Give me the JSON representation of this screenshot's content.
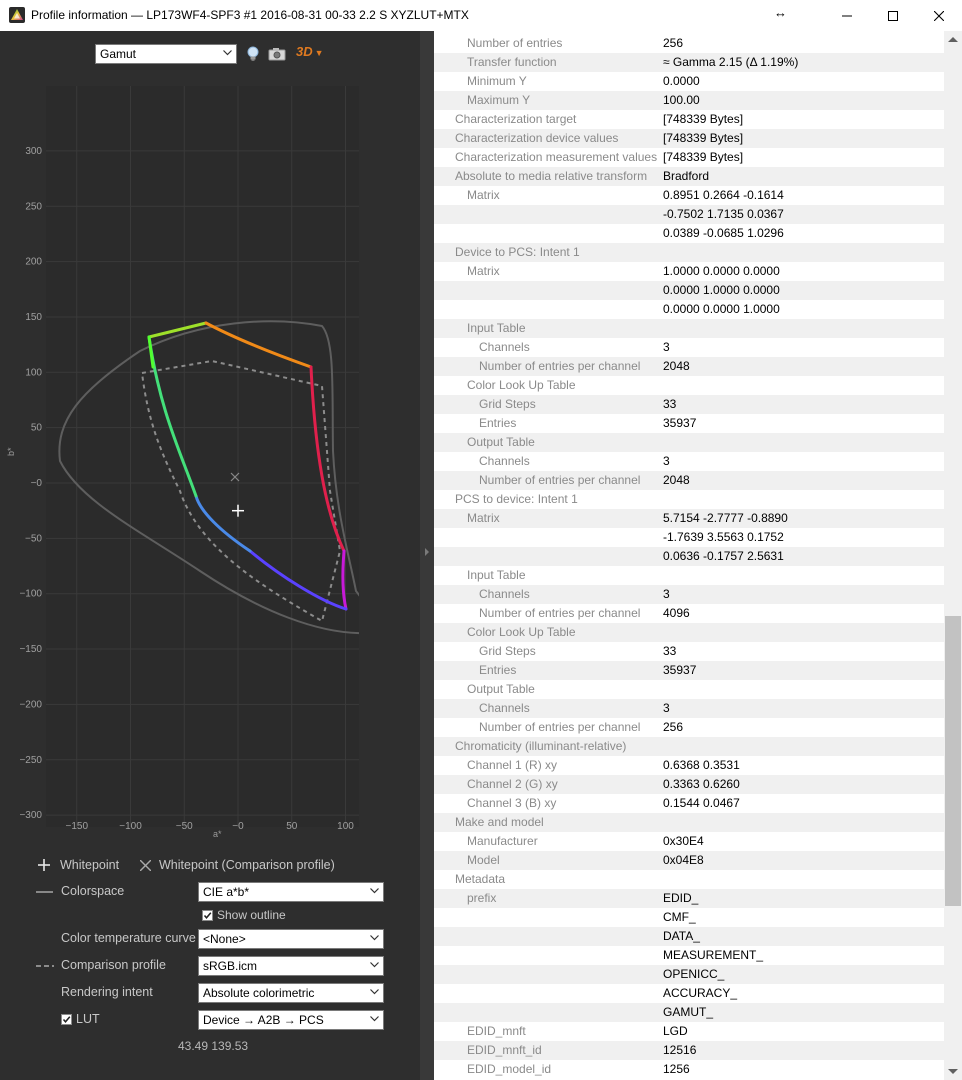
{
  "window": {
    "title": "Profile information — LP173WF4-SPF3 #1 2016-08-31 00-33 2.2 S XYZLUT+MTX",
    "minimize_glyph": "─",
    "maximize_glyph": "☐",
    "close_glyph": "✕",
    "resize_glyph": "↔"
  },
  "toolbar": {
    "view_select": "Gamut",
    "icons": [
      "lightbulb-icon",
      "camera-icon",
      "3d-icon"
    ],
    "three_d_label": "3D"
  },
  "plot": {
    "x_ticks": [
      "−150",
      "−100",
      "−50",
      "−0",
      "50",
      "100"
    ],
    "y_ticks": [
      "300",
      "250",
      "200",
      "150",
      "100",
      "50",
      "−0",
      "−50",
      "−100",
      "−150",
      "−200",
      "−250",
      "−300"
    ],
    "xlabel": "a*",
    "ylabel": "b*",
    "whitepoint": {
      "a": 0,
      "b": -25
    },
    "axis_range": {
      "a": [
        -180,
        110
      ],
      "b": [
        -335,
        330
      ]
    }
  },
  "legend": {
    "whitepoint": "Whitepoint",
    "whitepoint_comparison": "Whitepoint (Comparison profile)"
  },
  "options": {
    "colorspace_label": "Colorspace",
    "colorspace_value": "CIE a*b*",
    "show_outline_label": "Show outline",
    "show_outline_checked": true,
    "color_temp_label": "Color temperature curve",
    "color_temp_value": "<None>",
    "comparison_label": "Comparison profile",
    "comparison_value": "sRGB.icm",
    "rendering_label": "Rendering intent",
    "rendering_value": "Absolute colorimetric",
    "lut_label": "LUT",
    "lut_checked": true,
    "lut_value": "Device → A2B → PCS"
  },
  "readout": "43.49 139.53",
  "info_rows": [
    {
      "k": "Number of entries",
      "v": "256",
      "lvl": 1
    },
    {
      "k": "Transfer function",
      "v": "≈ Gamma 2.15 (Δ 1.19%)",
      "lvl": 1
    },
    {
      "k": "Minimum Y",
      "v": "0.0000",
      "lvl": 1
    },
    {
      "k": "Maximum Y",
      "v": "100.00",
      "lvl": 1
    },
    {
      "k": "Characterization target",
      "v": "[748339 Bytes]",
      "lvl": 0
    },
    {
      "k": "Characterization device values",
      "v": "[748339 Bytes]",
      "lvl": 0
    },
    {
      "k": "Characterization measurement values",
      "v": "[748339 Bytes]",
      "lvl": 0
    },
    {
      "k": "Absolute to media relative transform",
      "v": "Bradford",
      "lvl": 0
    },
    {
      "k": "Matrix",
      "v": "0.8951 0.2664 -0.1614",
      "lvl": 1
    },
    {
      "k": "",
      "v": "-0.7502 1.7135 0.0367",
      "lvl": 1
    },
    {
      "k": "",
      "v": "0.0389 -0.0685 1.0296",
      "lvl": 1
    },
    {
      "k": "Device to PCS: Intent 1",
      "v": "",
      "lvl": 0
    },
    {
      "k": "Matrix",
      "v": "1.0000 0.0000 0.0000",
      "lvl": 1
    },
    {
      "k": "",
      "v": "0.0000 1.0000 0.0000",
      "lvl": 1
    },
    {
      "k": "",
      "v": "0.0000 0.0000 1.0000",
      "lvl": 1
    },
    {
      "k": "Input Table",
      "v": "",
      "lvl": 1
    },
    {
      "k": "Channels",
      "v": "3",
      "lvl": 2
    },
    {
      "k": "Number of entries per channel",
      "v": "2048",
      "lvl": 2
    },
    {
      "k": "Color Look Up Table",
      "v": "",
      "lvl": 1
    },
    {
      "k": "Grid Steps",
      "v": "33",
      "lvl": 2
    },
    {
      "k": "Entries",
      "v": "35937",
      "lvl": 2
    },
    {
      "k": "Output Table",
      "v": "",
      "lvl": 1
    },
    {
      "k": "Channels",
      "v": "3",
      "lvl": 2
    },
    {
      "k": "Number of entries per channel",
      "v": "2048",
      "lvl": 2
    },
    {
      "k": "PCS to device: Intent 1",
      "v": "",
      "lvl": 0
    },
    {
      "k": "Matrix",
      "v": "5.7154 -2.7777 -0.8890",
      "lvl": 1
    },
    {
      "k": "",
      "v": "-1.7639 3.5563 0.1752",
      "lvl": 1
    },
    {
      "k": "",
      "v": "0.0636 -0.1757 2.5631",
      "lvl": 1
    },
    {
      "k": "Input Table",
      "v": "",
      "lvl": 1
    },
    {
      "k": "Channels",
      "v": "3",
      "lvl": 2
    },
    {
      "k": "Number of entries per channel",
      "v": "4096",
      "lvl": 2
    },
    {
      "k": "Color Look Up Table",
      "v": "",
      "lvl": 1
    },
    {
      "k": "Grid Steps",
      "v": "33",
      "lvl": 2
    },
    {
      "k": "Entries",
      "v": "35937",
      "lvl": 2
    },
    {
      "k": "Output Table",
      "v": "",
      "lvl": 1
    },
    {
      "k": "Channels",
      "v": "3",
      "lvl": 2
    },
    {
      "k": "Number of entries per channel",
      "v": "256",
      "lvl": 2
    },
    {
      "k": "Chromaticity (illuminant-relative)",
      "v": "",
      "lvl": 0
    },
    {
      "k": "Channel 1 (R) xy",
      "v": "0.6368 0.3531",
      "lvl": 1
    },
    {
      "k": "Channel 2 (G) xy",
      "v": "0.3363 0.6260",
      "lvl": 1
    },
    {
      "k": "Channel 3 (B) xy",
      "v": "0.1544 0.0467",
      "lvl": 1
    },
    {
      "k": "Make and model",
      "v": "",
      "lvl": 0
    },
    {
      "k": "Manufacturer",
      "v": "0x30E4",
      "lvl": 1
    },
    {
      "k": "Model",
      "v": "0x04E8",
      "lvl": 1
    },
    {
      "k": "Metadata",
      "v": "",
      "lvl": 0
    },
    {
      "k": "prefix",
      "v": "EDID_",
      "lvl": 1
    },
    {
      "k": "",
      "v": "CMF_",
      "lvl": 1
    },
    {
      "k": "",
      "v": "DATA_",
      "lvl": 1
    },
    {
      "k": "",
      "v": "MEASUREMENT_",
      "lvl": 1
    },
    {
      "k": "",
      "v": "OPENICC_",
      "lvl": 1
    },
    {
      "k": "",
      "v": "ACCURACY_",
      "lvl": 1
    },
    {
      "k": "",
      "v": "GAMUT_",
      "lvl": 1
    },
    {
      "k": "EDID_mnft",
      "v": "LGD",
      "lvl": 1
    },
    {
      "k": "EDID_mnft_id",
      "v": "12516",
      "lvl": 1
    },
    {
      "k": "EDID_model_id",
      "v": "1256",
      "lvl": 1
    }
  ]
}
